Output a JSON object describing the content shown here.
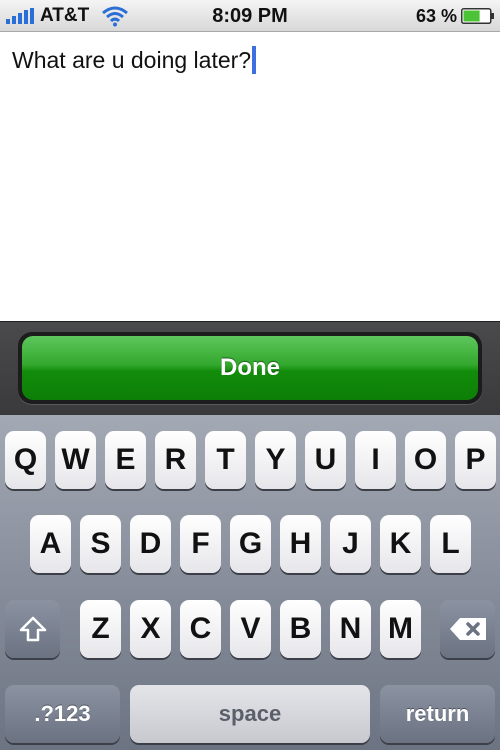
{
  "status_bar": {
    "carrier": "AT&T",
    "time": "8:09 PM",
    "battery_percent": "63 %",
    "battery_level": 0.63
  },
  "message": {
    "text": "What are u doing later?"
  },
  "done_bar": {
    "done_label": "Done",
    "accent_color": "#1d9a15"
  },
  "keyboard": {
    "row1": [
      "Q",
      "W",
      "E",
      "R",
      "T",
      "Y",
      "U",
      "I",
      "O",
      "P"
    ],
    "row2": [
      "A",
      "S",
      "D",
      "F",
      "G",
      "H",
      "J",
      "K",
      "L"
    ],
    "row3": [
      "Z",
      "X",
      "C",
      "V",
      "B",
      "N",
      "M"
    ],
    "shift_icon": "shift-arrow-icon",
    "delete_icon": "backspace-icon",
    "numbers_label": ".?123",
    "space_label": "space",
    "return_label": "return"
  }
}
